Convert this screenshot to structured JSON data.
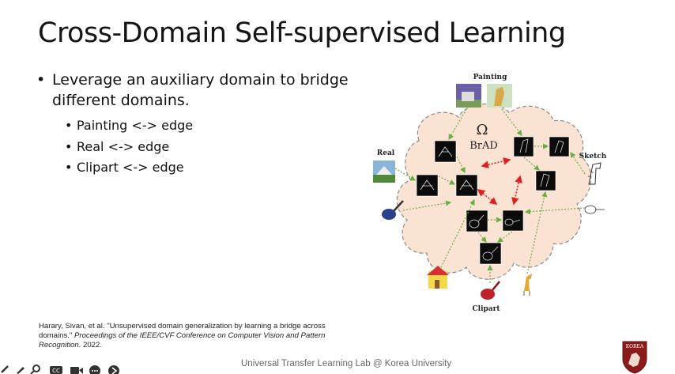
{
  "slide": {
    "title": "Cross-Domain Self-supervised Learning",
    "bullet_main": "Leverage an auxiliary domain to bridge different domains.",
    "sub_bullets": [
      "Painting <-> edge",
      "Real <-> edge",
      "Clipart <-> edge"
    ]
  },
  "figure": {
    "labels": {
      "painting": "Painting",
      "real": "Real",
      "sketch": "Sketch",
      "clipart": "Clipart",
      "omega": "Ω",
      "brad": "BrAD"
    }
  },
  "citation": {
    "part1": "Harary, Sivan, et al. \"Unsupervised domain generalization by learning a bridge across domains.\" ",
    "venue": "Proceedings of the IEEE/CVF Conference on Computer Vision and Pattern Recognition",
    "part2": ". 2022."
  },
  "footer": {
    "text": "Universal Transfer Learning Lab @ Korea University"
  },
  "logo": {
    "text": "KOREA",
    "color": "#8b1a1a"
  },
  "player_controls": {
    "icons": [
      "pencil-icon",
      "search-icon",
      "captions-icon",
      "camera-icon",
      "more-icon",
      "next-icon"
    ]
  },
  "colors": {
    "cloud_fill": "#fbe3d4",
    "cloud_stroke": "#8a8a8a",
    "green_arrow": "#6cae45",
    "red_arrow": "#e02020"
  }
}
